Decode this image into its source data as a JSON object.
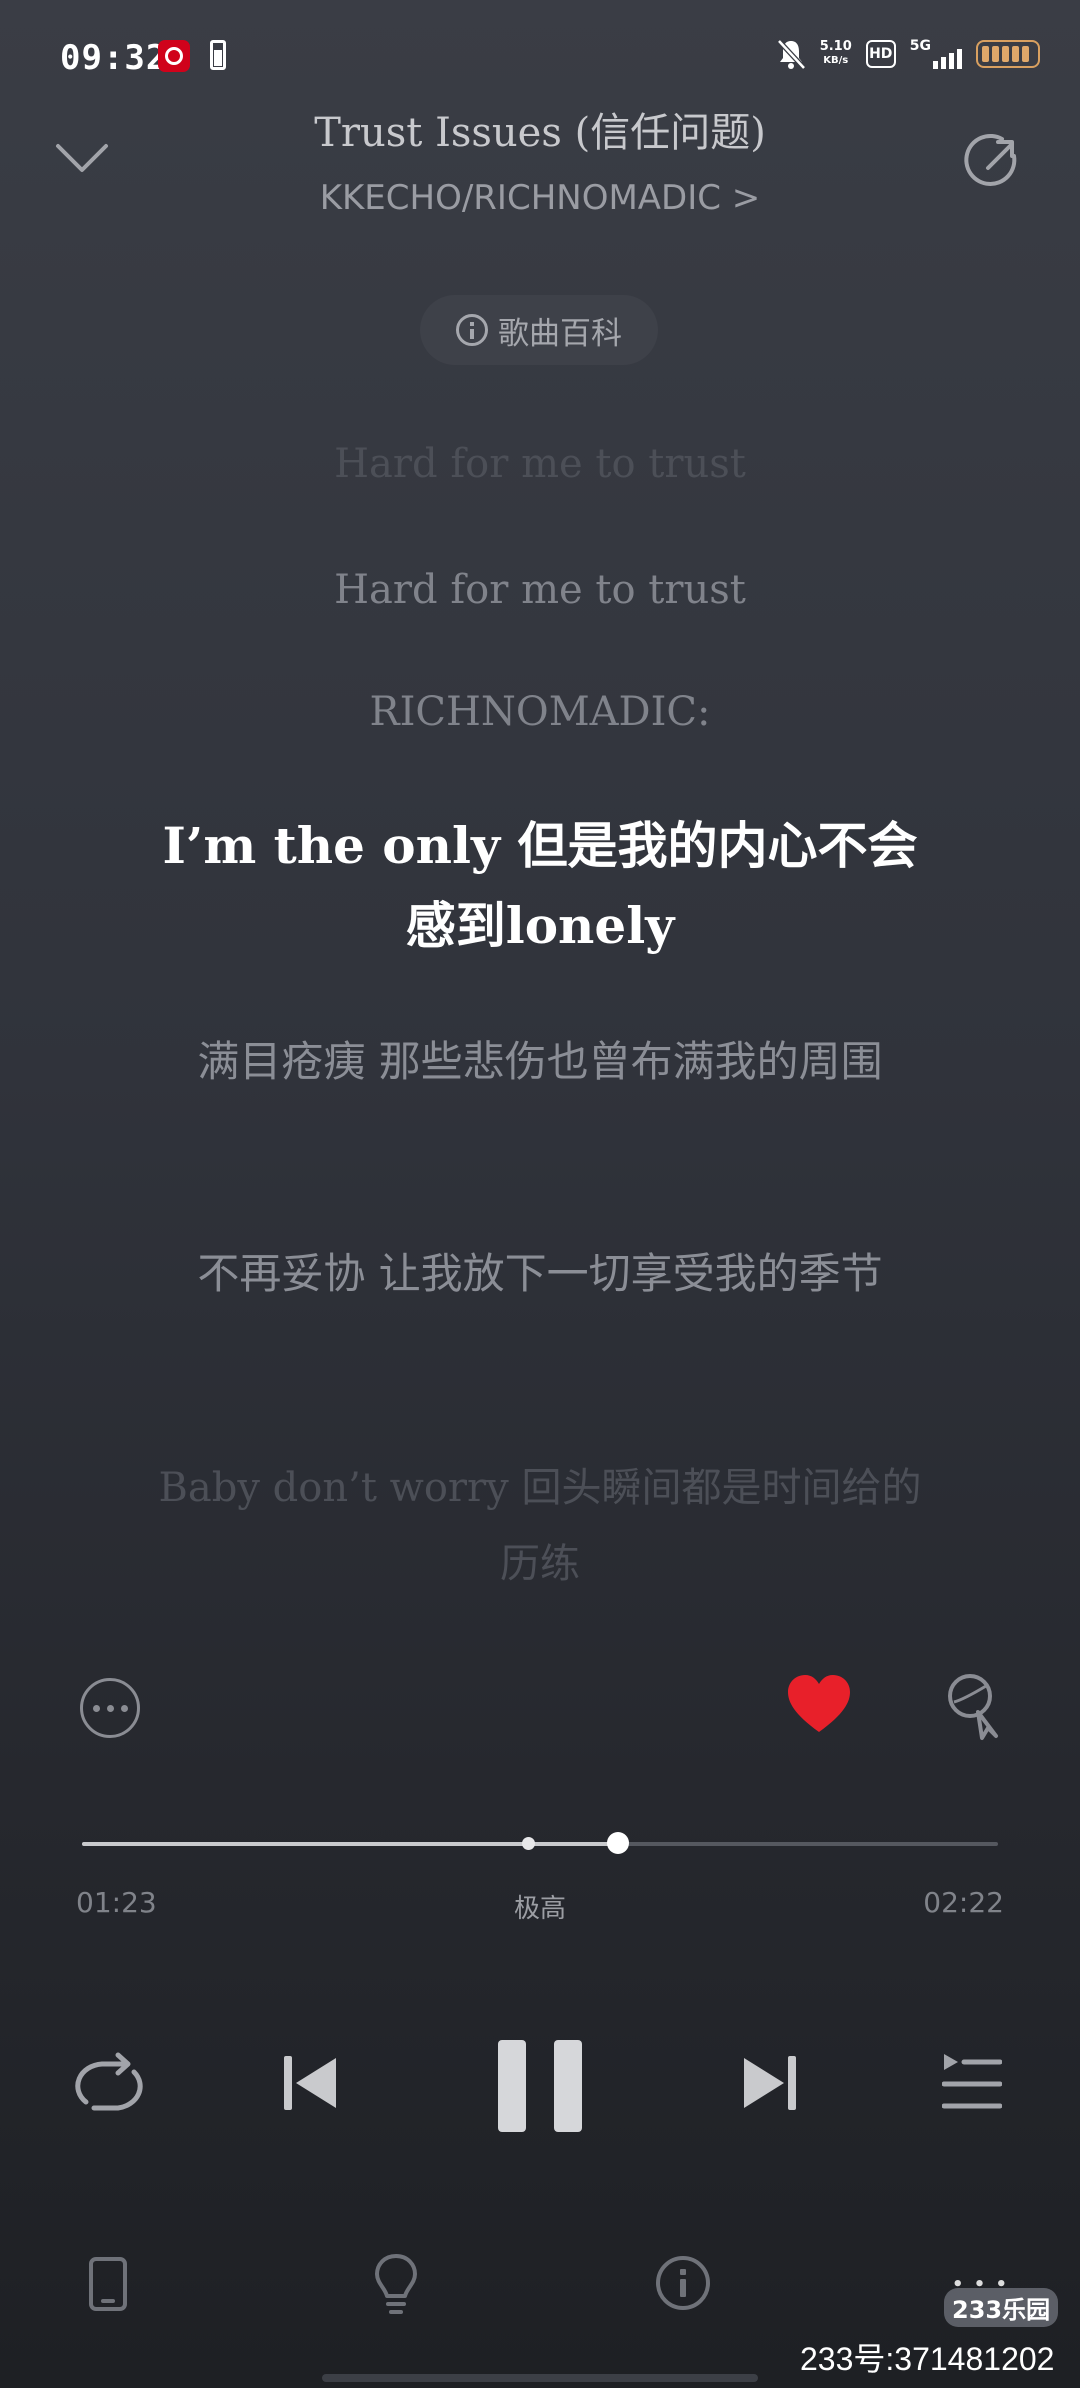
{
  "status_bar": {
    "time": "09:32",
    "net_speed_value": "5.10",
    "net_speed_unit": "KB/s",
    "hd": "HD",
    "network": "5G"
  },
  "header": {
    "title": "Trust Issues (信任问题)",
    "artist": "KKECHO/RICHNOMADIC >",
    "wiki_label": "歌曲百科"
  },
  "lyrics": [
    {
      "text": "Hard for me to trust",
      "state": "faint"
    },
    {
      "text": "Hard for me to trust",
      "state": "dim"
    },
    {
      "text": "RICHNOMADIC:",
      "state": "dim"
    },
    {
      "text": "I’m the only 但是我的内心不会感到lonely",
      "state": "active"
    },
    {
      "text": "满目疮痍 那些悲伤也曾布满我的周围",
      "state": "dim"
    },
    {
      "text": "不再妥协 让我放下一切享受我的季节",
      "state": "dim"
    },
    {
      "text": "Baby don’t worry 回头瞬间都是时间给的历练",
      "state": "faint"
    }
  ],
  "player": {
    "current_time": "01:23",
    "total_time": "02:22",
    "quality": "极高",
    "progress": 0.585,
    "buffer_marker": 0.487,
    "liked": true,
    "accent_color": "#e8202a"
  },
  "watermark": {
    "logo": "233乐园",
    "id_text": "233号:371481202"
  }
}
